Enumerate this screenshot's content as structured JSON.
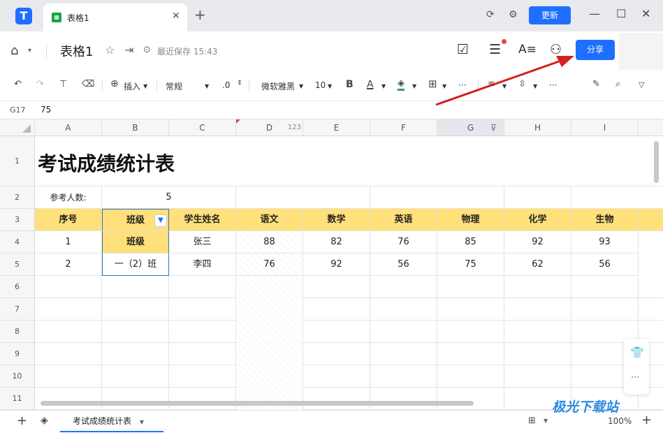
{
  "tabbar": {
    "tab_title": "表格1",
    "update_label": "更新"
  },
  "header": {
    "doc_title": "表格1",
    "save_status": "最近保存 15:43",
    "share_label": "分享"
  },
  "toolbar": {
    "insert_label": "插入",
    "format_label": "常规",
    "decimal_label": ".0",
    "font_name": "微软雅黑",
    "font_size": "10",
    "bold_label": "B",
    "font_color_label": "A",
    "more_label": "···",
    "font_color": "#111111",
    "fill_color": "#2ea44f"
  },
  "formula_bar": {
    "cell_ref": "G17",
    "value": "75"
  },
  "grid": {
    "columns": [
      "A",
      "B",
      "C",
      "D",
      "E",
      "F",
      "G",
      "H",
      "I"
    ],
    "col_d_badge": "123",
    "rows": [
      "1",
      "2",
      "3",
      "4",
      "5",
      "6",
      "7",
      "8",
      "9",
      "10",
      "11"
    ],
    "title": "考试成绩统计表",
    "count_label": "参考人数:",
    "count_value": "5",
    "headers": [
      "序号",
      "班级",
      "学生姓名",
      "语文",
      "数学",
      "英语",
      "物理",
      "化学",
      "生物"
    ],
    "data_rows": [
      [
        "1",
        "班级",
        "张三",
        "88",
        "82",
        "76",
        "85",
        "92",
        "93"
      ],
      [
        "2",
        "一（2）班",
        "李四",
        "76",
        "92",
        "56",
        "75",
        "62",
        "56"
      ]
    ],
    "header_fill": "#ffe07a"
  },
  "bottom": {
    "sheet_tab": "考试成绩统计表",
    "zoom": "100%"
  },
  "watermark": "极光下载站"
}
